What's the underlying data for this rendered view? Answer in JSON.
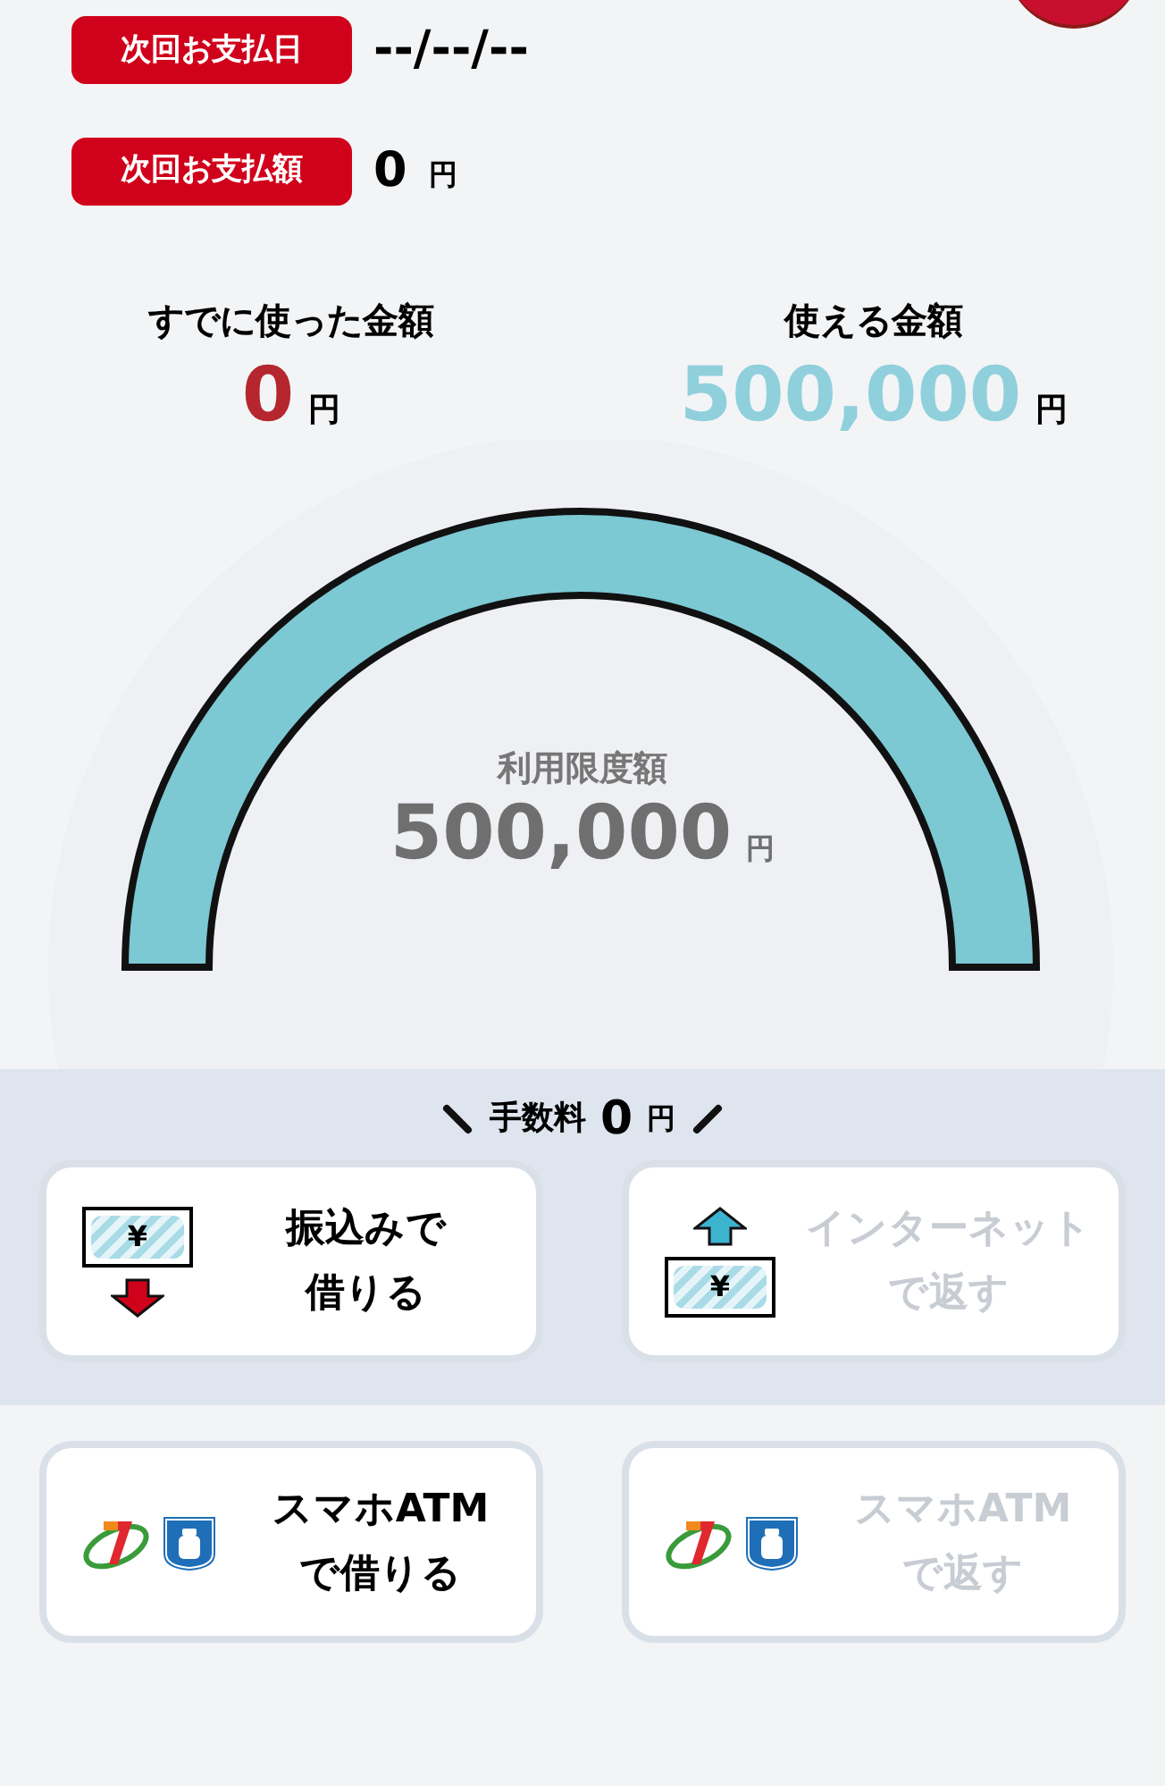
{
  "payment": [
    {
      "label": "次回お支払日",
      "value": "--/--/--"
    },
    {
      "label": "次回お支払額",
      "value": "0",
      "unit": "円"
    }
  ],
  "amounts": [
    {
      "kind": "used",
      "label": "すでに使った金額",
      "value": "0",
      "unit": "円"
    },
    {
      "kind": "available",
      "label": "使える金額",
      "value": "500,000",
      "unit": "円"
    }
  ],
  "gauge": {
    "label": "利用限度額",
    "value": "500,000",
    "unit": "円"
  },
  "fee": {
    "label": "手数料",
    "value": "0",
    "unit": "円"
  },
  "action_rows": [
    {
      "actions": [
        {
          "kind": "transfer",
          "symbol": "¥",
          "lines": [
            "振込みで",
            "借りる"
          ],
          "disabled": false
        },
        {
          "kind": "internet",
          "symbol": "¥",
          "lines": [
            "インターネット",
            "で返す"
          ],
          "disabled": true
        }
      ]
    },
    {
      "actions": [
        {
          "kind": "atm",
          "lines": [
            "スマホATM",
            "で借りる"
          ],
          "disabled": false
        },
        {
          "kind": "atm",
          "lines": [
            "スマホATM",
            "で返す"
          ],
          "disabled": true
        }
      ]
    }
  ]
}
